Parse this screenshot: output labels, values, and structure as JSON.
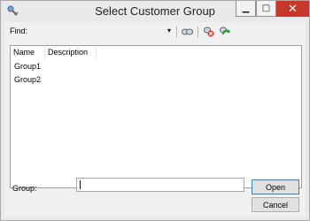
{
  "window": {
    "title": "Select Customer Group",
    "controls": {
      "minimize_glyph": "▁",
      "maximize_glyph": "□",
      "close_glyph": "✕"
    },
    "icon": "app-icon"
  },
  "toolbar": {
    "find_label": "Find:",
    "find_value": "",
    "dropdown_glyph": "▾",
    "icons": [
      "find-icon",
      "remove-filter-icon",
      "refresh-icon"
    ]
  },
  "list": {
    "columns": [
      "Name",
      "Description"
    ],
    "rows": [
      {
        "name": "Group1",
        "description": ""
      },
      {
        "name": "Group2",
        "description": ""
      }
    ]
  },
  "form": {
    "group_label": "Group:",
    "group_value": ""
  },
  "buttons": {
    "open_label": "Open",
    "cancel_label": "Cancel"
  },
  "colors": {
    "close_button": "#c7382c",
    "default_button_border": "#3c7fb1"
  }
}
